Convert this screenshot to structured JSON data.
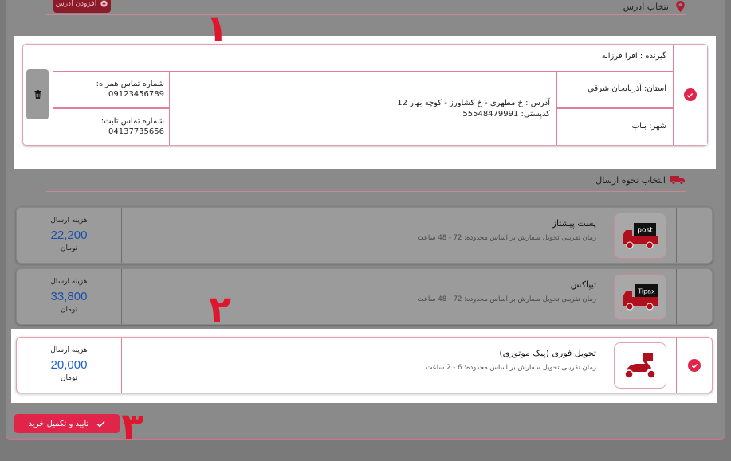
{
  "address_section": {
    "title": "انتخاب آدرس",
    "add_button": "افزودن آدرس",
    "card": {
      "recipient": "گیرنده : افرا فرزانه",
      "province": "استان: آذربایجان شرقي",
      "city": "شهر: بناب",
      "address_line": "آدرس : خ مطهری - خ کشاورز - کوچه بهار 12",
      "postal_code": "کدپستی: 55548479991",
      "mobile_label": "شماره تماس همراه:",
      "mobile_value": "09123456789",
      "phone_label": "شماره تماس ثابت:",
      "phone_value": "04137735656"
    }
  },
  "shipping_section": {
    "title": "انتخاب نحوه ارسال",
    "methods": [
      {
        "name": "پست پیشتاز",
        "description": "زمان تقریبی تحویل سفارش بر اساس محدوده: 72 - 48 ساعت",
        "cost_label": "هزینه ارسال",
        "cost_value": "22,200",
        "cost_unit": "تومان",
        "logo_text": "post",
        "selected": false
      },
      {
        "name": "تیپاکس",
        "description": "زمان تقریبی تحویل سفارش بر اساس محدوده: 72 - 48 ساعت",
        "cost_label": "هزینه ارسال",
        "cost_value": "33,800",
        "cost_unit": "تومان",
        "logo_text": "Tipax",
        "selected": false
      },
      {
        "name": "تحویل فوری (پیک موتوری)",
        "description": "زمان تقریبی تحویل سفارش بر اساس محدوده: 6 - 2 ساعت",
        "cost_label": "هزینه ارسال",
        "cost_value": "20,000",
        "cost_unit": "تومان",
        "logo_text": "",
        "selected": true
      }
    ]
  },
  "confirm_button": "تایید و تکمیل خرید",
  "annotations": [
    "۱",
    "۲",
    "۳"
  ],
  "colors": {
    "accent": "#e0244a",
    "price": "#1a5fd8",
    "annotation": "#e0162e"
  }
}
